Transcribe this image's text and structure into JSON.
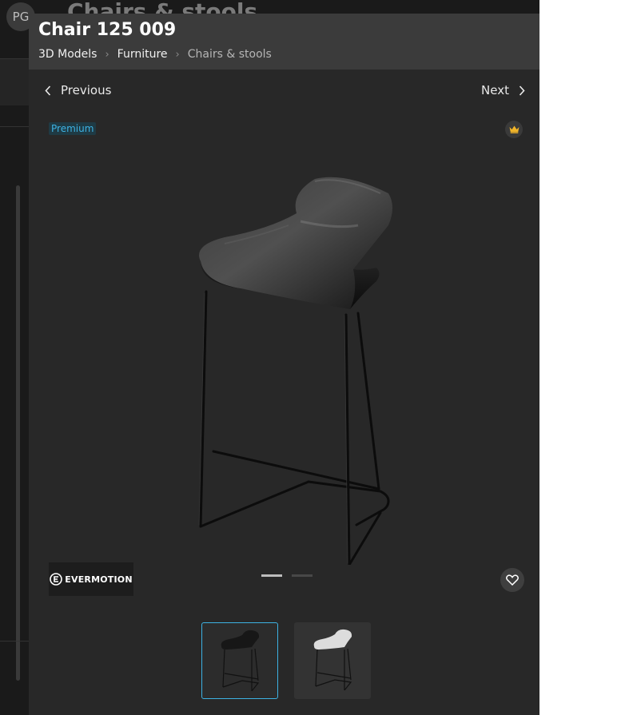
{
  "background": {
    "avatar_initials": "PG",
    "page_title": "Chairs & stools"
  },
  "modal": {
    "title": "Chair 125 009",
    "breadcrumb": [
      {
        "label": "3D Models"
      },
      {
        "label": "Furniture"
      },
      {
        "label": "Chairs & stools"
      }
    ],
    "separator": "›",
    "prev_label": "Previous",
    "next_label": "Next",
    "badge": "Premium",
    "brand": "EVERMOTION",
    "slides": {
      "count": 2,
      "active": 1
    },
    "thumbnails": [
      {
        "variant": "black-stool",
        "selected": true
      },
      {
        "variant": "white-stool",
        "selected": false
      }
    ]
  },
  "colors": {
    "accent": "#3db2e3",
    "crown": "#f0b429",
    "modal_bg": "#282828",
    "header_bg": "#3b3b3b"
  },
  "icons": {
    "prev": "chevron-left-icon",
    "next": "chevron-right-icon",
    "crown": "crown-icon",
    "favorite": "heart-icon",
    "brand": "evermotion-logo"
  }
}
